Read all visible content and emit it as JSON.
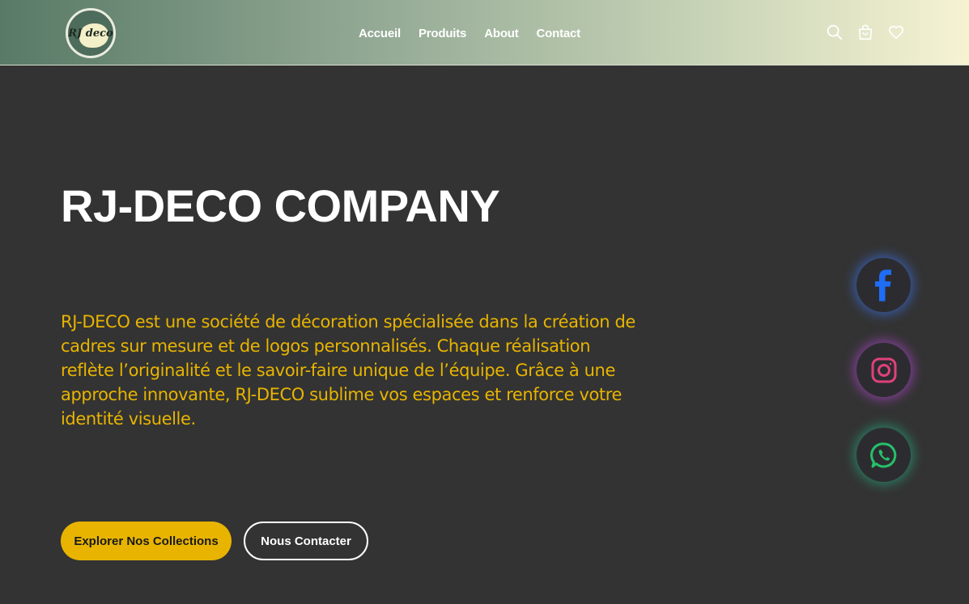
{
  "brand": {
    "logo_text": "RJ deco",
    "accent": "#e8b400",
    "background": "#333333"
  },
  "nav": {
    "links": [
      "Accueil",
      "Produits",
      "About",
      "Contact"
    ],
    "icons": [
      "search-icon",
      "shopping-bag-icon",
      "heart-icon"
    ]
  },
  "hero": {
    "title": "RJ-DECO COMPANY",
    "description": "RJ-DECO est une société de décoration spécialisée dans la création de cadres sur mesure et de logos personnalisés. Chaque réalisation reflète l’originalité et le savoir-faire unique de l’équipe. Grâce à une approche innovante, RJ-DECO sublime vos espaces et renforce votre identité visuelle.",
    "primary_button": "Explorer Nos Collections",
    "secondary_button": "Nous Contacter"
  },
  "social": [
    {
      "name": "facebook-icon",
      "color": "#1f6cf5"
    },
    {
      "name": "instagram-icon",
      "color": "#e0417a"
    },
    {
      "name": "whatsapp-icon",
      "color": "#26c06a"
    }
  ]
}
